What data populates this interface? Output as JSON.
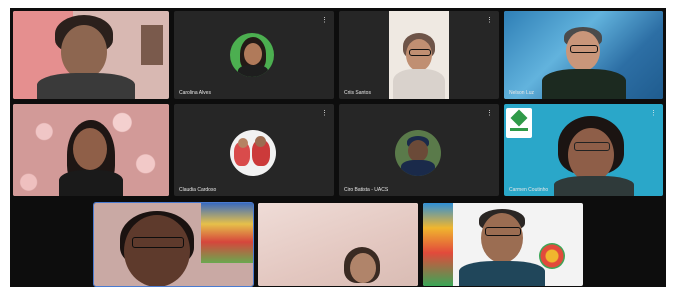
{
  "participants": [
    {
      "name": "",
      "mic": "",
      "video": "on"
    },
    {
      "name": "Carolina Alves",
      "mic": "⋮",
      "video": "off"
    },
    {
      "name": "Criis Santos",
      "mic": "⋮",
      "video": "on"
    },
    {
      "name": "Nelson Luz",
      "mic": "",
      "video": "on"
    },
    {
      "name": "",
      "mic": "",
      "video": "on"
    },
    {
      "name": "Claudia Cardoso",
      "mic": "⋮",
      "video": "off"
    },
    {
      "name": "Ciro Batista - UACS",
      "mic": "⋮",
      "video": "off"
    },
    {
      "name": "Carmen Coutinho",
      "mic": "⋮",
      "video": "on"
    },
    {
      "name": "",
      "mic": "",
      "video": "on"
    },
    {
      "name": "",
      "mic": "",
      "video": "on"
    },
    {
      "name": "",
      "mic": "",
      "video": "on"
    }
  ],
  "colors": {
    "grid_background": "#0d0d0d",
    "tile_dark": "#262626",
    "active_speaker_border": "#4a7bd0"
  }
}
